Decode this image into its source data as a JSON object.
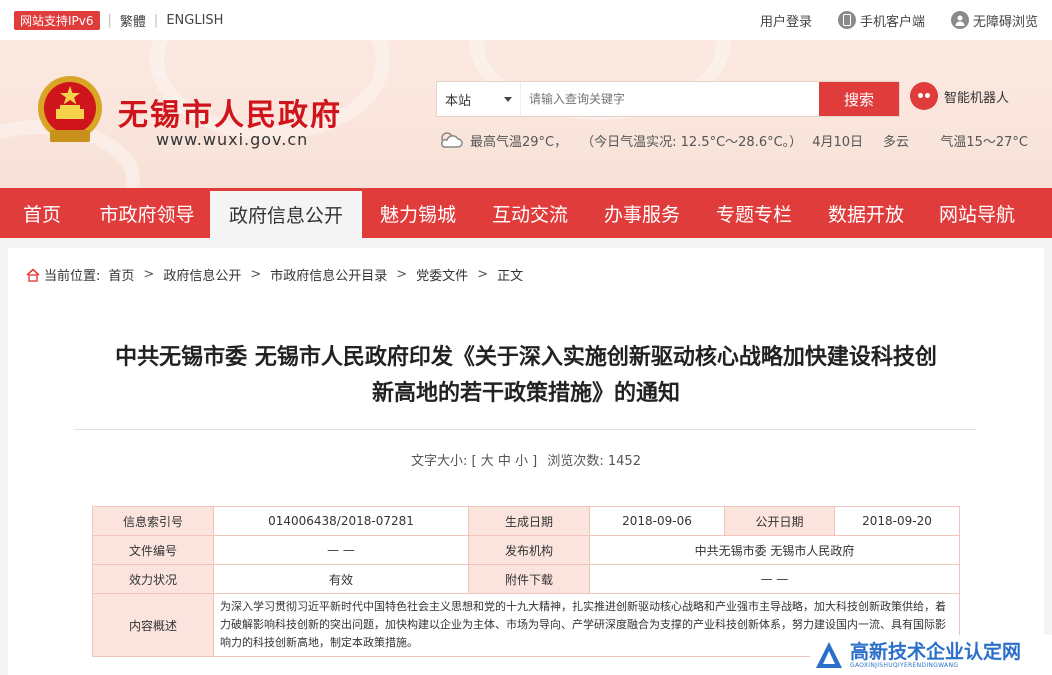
{
  "topbar": {
    "ipv6": "网站支持IPv6",
    "traditional": "繁體",
    "english": "ENGLISH",
    "login": "用户登录",
    "mobile": "手机客户端",
    "accessible": "无障碍浏览"
  },
  "header": {
    "site_title": "无锡市人民政府",
    "site_url": "www.wuxi.gov.cn",
    "search": {
      "scope": "本站",
      "placeholder": "请输入查询关键字",
      "button": "搜索"
    },
    "robot": "智能机器人",
    "weather": {
      "max_temp": "最高气温29°C，",
      "today": "（今日气温实况: 12.5°C～28.6°C。）",
      "date": "4月10日",
      "condition": "多云",
      "range": "气温15～27°C"
    }
  },
  "nav": {
    "items": [
      "首页",
      "市政府领导",
      "政府信息公开",
      "魅力锡城",
      "互动交流",
      "办事服务",
      "专题专栏",
      "数据开放",
      "网站导航"
    ],
    "active_index": 2
  },
  "breadcrumb": {
    "prefix": "当前位置:",
    "items": [
      "首页",
      "政府信息公开",
      "市政府信息公开目录",
      "党委文件",
      "正文"
    ]
  },
  "article": {
    "title_line1": "中共无锡市委 无锡市人民政府印发《关于深入实施创新驱动核心战略加快建设科技创",
    "title_line2": "新高地的若干政策措施》的通知",
    "font_size_label": "文字大小:",
    "font_size_options": "[ 大 中 小 ]",
    "views_label": "浏览次数:",
    "views": "1452"
  },
  "info_table": {
    "index_label": "信息索引号",
    "index_value": "014006438/2018-07281",
    "created_label": "生成日期",
    "created_value": "2018-09-06",
    "published_label": "公开日期",
    "published_value": "2018-09-20",
    "doc_no_label": "文件编号",
    "doc_no_value": "— —",
    "issuer_label": "发布机构",
    "issuer_value": "中共无锡市委 无锡市人民政府",
    "status_label": "效力状况",
    "status_value": "有效",
    "attachment_label": "附件下载",
    "attachment_value": "— —",
    "summary_label": "内容概述",
    "summary_value": "为深入学习贯彻习近平新时代中国特色社会主义思想和党的十九大精神，扎实推进创新驱动核心战略和产业强市主导战略，加大科技创新政策供给，着力破解影响科技创新的突出问题，加快构建以企业为主体、市场为导向、产学研深度融合为支撑的产业科技创新体系，努力建设国内一流、具有国际影响力的科技创新高地，制定本政策措施。"
  },
  "watermark": {
    "text": "高新技术企业认定网",
    "subtext": "GAOXINJISHUQIYERENDINGWANG"
  },
  "colors": {
    "brand_red": "#e03c3c",
    "title_red": "#d0141b",
    "table_label_bg": "#fbe4de",
    "watermark_blue": "#2a6fc9"
  }
}
